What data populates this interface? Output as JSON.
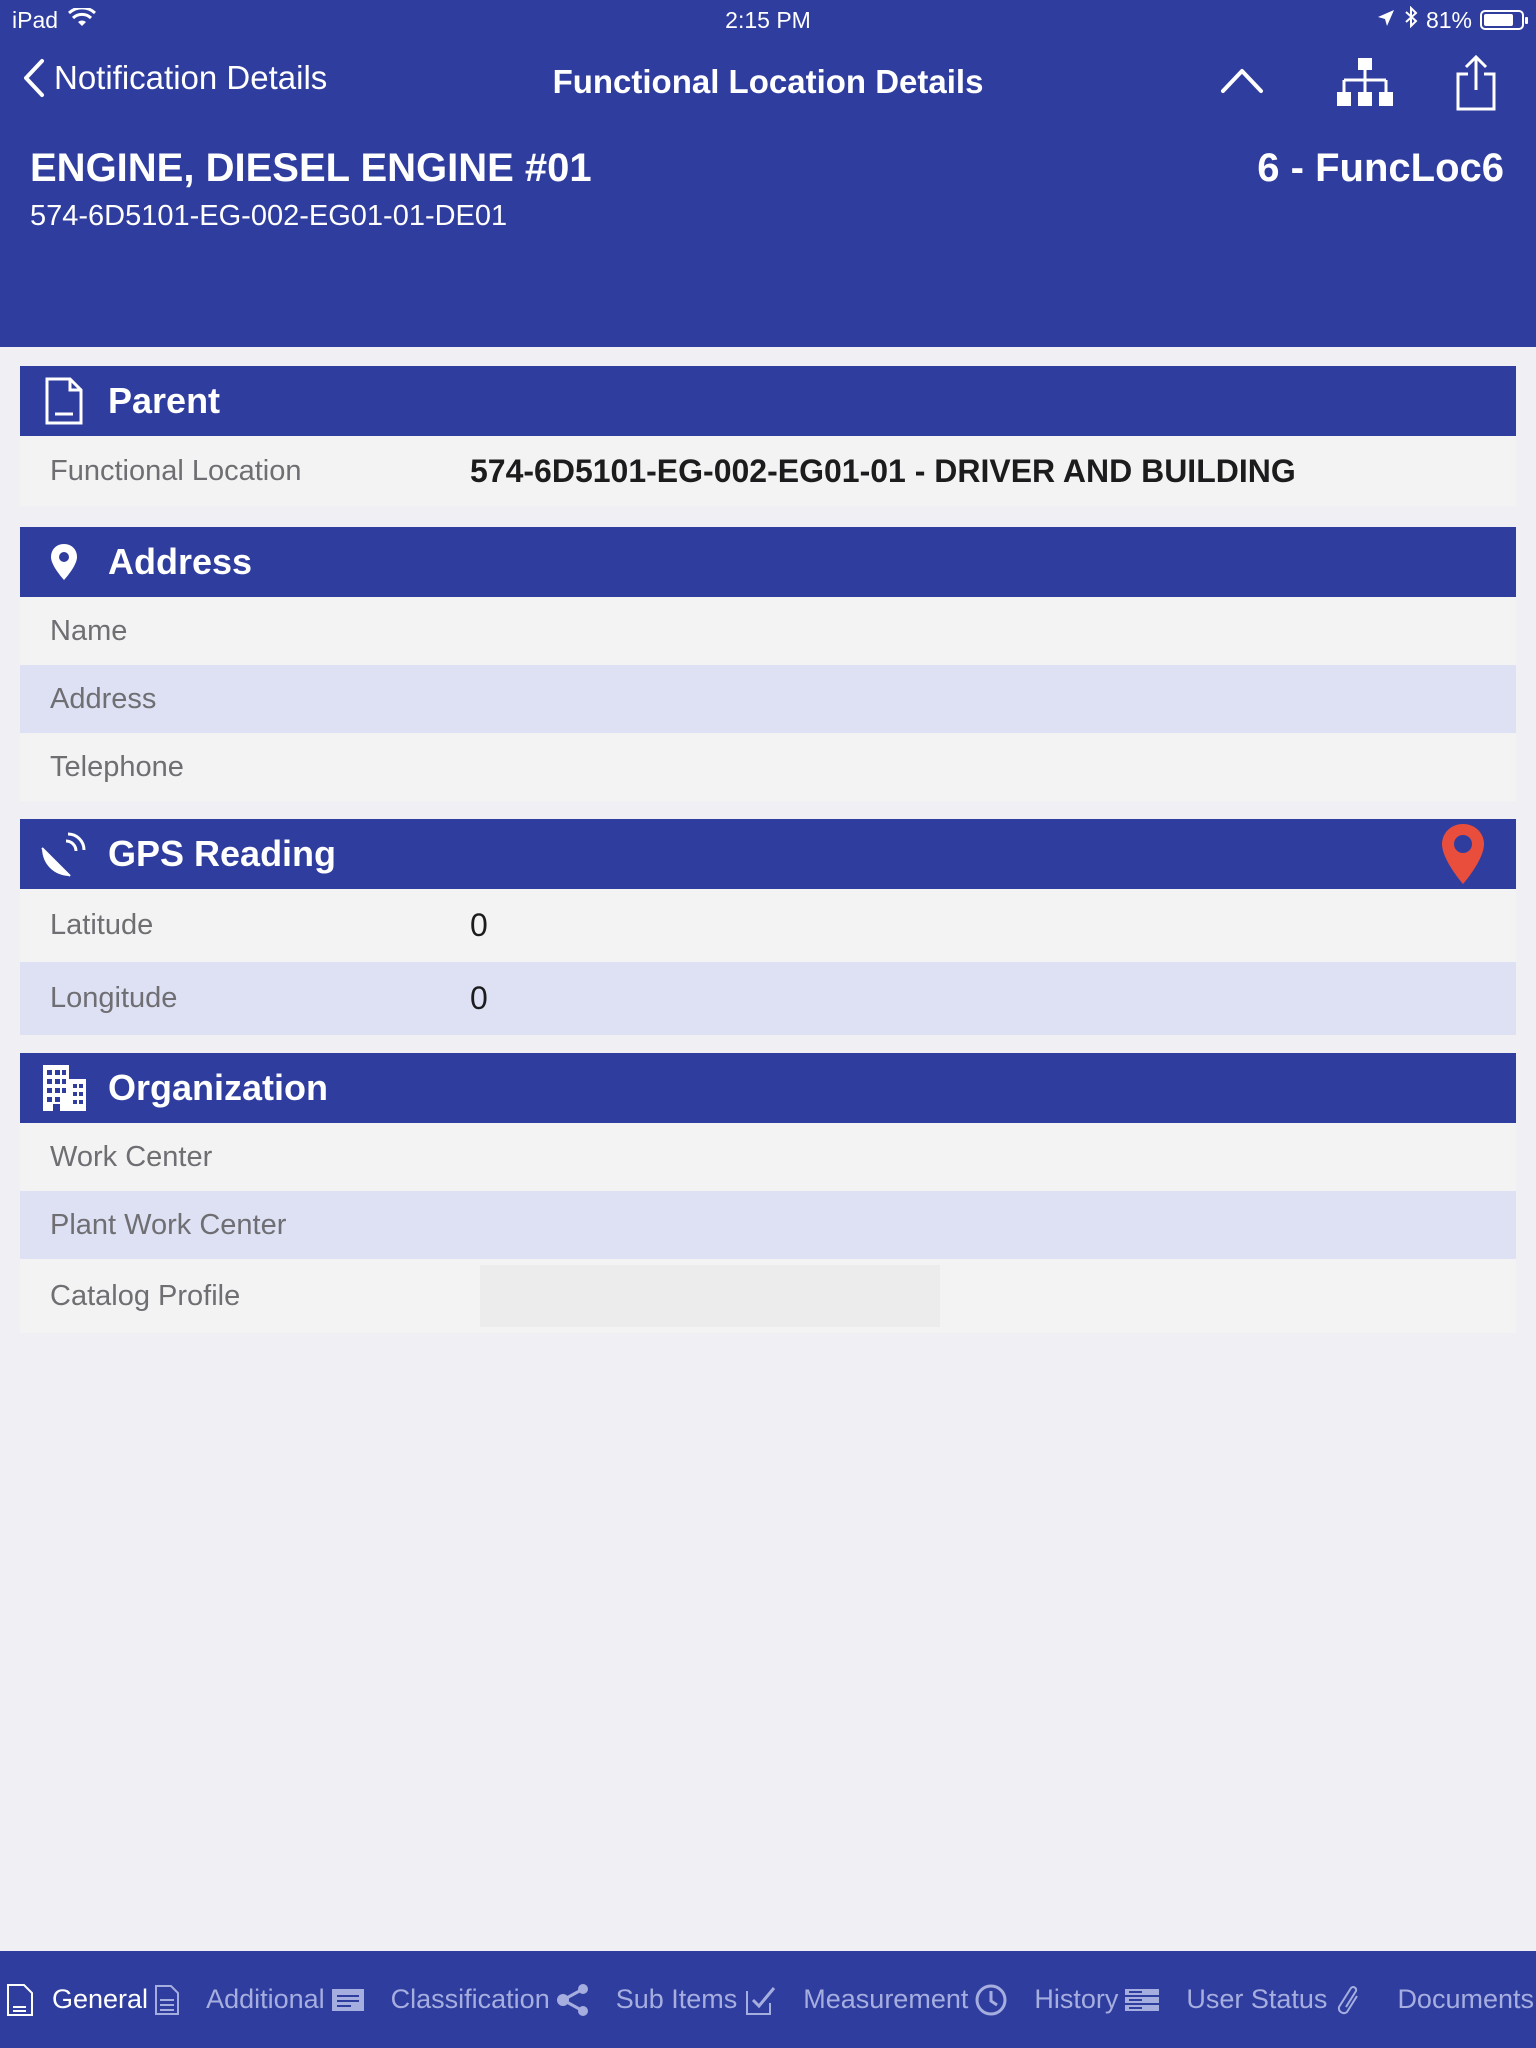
{
  "colors": {
    "brand": "#2f3d9e",
    "alt_row": "#dde1f3",
    "row": "#f3f3f3",
    "pin": "#e94e3c"
  },
  "status_bar": {
    "device": "iPad",
    "time": "2:15 PM",
    "battery": "81%",
    "battery_level": 0.81
  },
  "nav": {
    "back_label": "Notification Details",
    "title": "Functional Location Details"
  },
  "header": {
    "title": "ENGINE, DIESEL ENGINE #01",
    "id": "574-6D5101-EG-002-EG01-01-DE01",
    "code": "6 - FuncLoc6"
  },
  "sections": {
    "parent": {
      "title": "Parent",
      "icon": "document-icon",
      "functional_location_label": "Functional Location",
      "functional_location_value": "574-6D5101-EG-002-EG01-01 - DRIVER AND BUILDING"
    },
    "address": {
      "title": "Address",
      "icon": "map-pin-icon",
      "name_label": "Name",
      "address_label": "Address",
      "telephone_label": "Telephone"
    },
    "gps": {
      "title": "GPS Reading",
      "icon": "satellite-dish-icon",
      "latitude_label": "Latitude",
      "latitude_value": "0",
      "longitude_label": "Longitude",
      "longitude_value": "0"
    },
    "organization": {
      "title": "Organization",
      "icon": "building-icon",
      "work_center_label": "Work Center",
      "plant_work_center_label": "Plant Work Center",
      "catalog_profile_label": "Catalog Profile"
    }
  },
  "tabs": [
    {
      "label": "General",
      "icon": "document-icon",
      "active": true
    },
    {
      "label": "Additional",
      "icon": "list-icon"
    },
    {
      "label": "Classification",
      "icon": "share-icon"
    },
    {
      "label": "Sub Items",
      "icon": "checklist-icon"
    },
    {
      "label": "Measurement",
      "icon": "gauge-icon"
    },
    {
      "label": "History",
      "icon": "history-icon"
    },
    {
      "label": "User Status",
      "icon": "paperclip-icon"
    },
    {
      "label": "Documents",
      "icon": ""
    }
  ]
}
